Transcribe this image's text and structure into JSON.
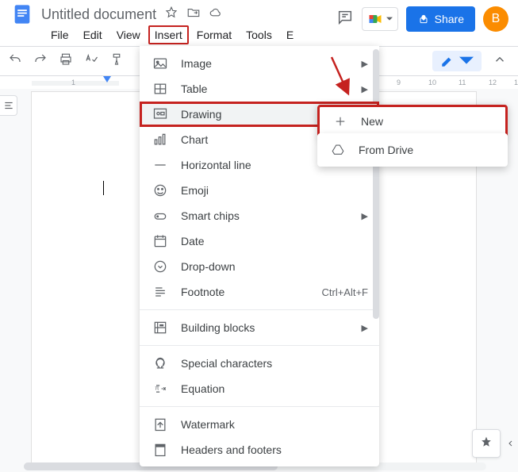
{
  "header": {
    "doc_title": "Untitled document",
    "share_label": "Share",
    "avatar_letter": "B"
  },
  "menubar": [
    "File",
    "Edit",
    "View",
    "Insert",
    "Format",
    "Tools",
    "E"
  ],
  "menubar_active_index": 3,
  "ruler_labels": [
    "1",
    "9",
    "10",
    "11",
    "12",
    "13"
  ],
  "insert_menu": {
    "items": [
      {
        "id": "image",
        "label": "Image",
        "submenu": true
      },
      {
        "id": "table",
        "label": "Table",
        "submenu": true
      },
      {
        "id": "drawing",
        "label": "Drawing",
        "submenu": true,
        "hover": true,
        "highlight": true
      },
      {
        "id": "chart",
        "label": "Chart",
        "submenu": true
      },
      {
        "id": "hline",
        "label": "Horizontal line"
      },
      {
        "id": "emoji",
        "label": "Emoji"
      },
      {
        "id": "smart",
        "label": "Smart chips",
        "submenu": true
      },
      {
        "id": "date",
        "label": "Date"
      },
      {
        "id": "dropdown",
        "label": "Drop-down"
      },
      {
        "id": "footnote",
        "label": "Footnote",
        "shortcut": "Ctrl+Alt+F"
      },
      {
        "sep": true
      },
      {
        "id": "building",
        "label": "Building blocks",
        "submenu": true
      },
      {
        "sep": true
      },
      {
        "id": "special",
        "label": "Special characters"
      },
      {
        "id": "equation",
        "label": "Equation"
      },
      {
        "sep": true
      },
      {
        "id": "watermark",
        "label": "Watermark"
      },
      {
        "id": "headers",
        "label": "Headers and footers"
      }
    ]
  },
  "drawing_submenu": {
    "items": [
      {
        "id": "new",
        "label": "New",
        "highlight_row": true
      },
      {
        "id": "drive",
        "label": "From Drive"
      }
    ]
  }
}
